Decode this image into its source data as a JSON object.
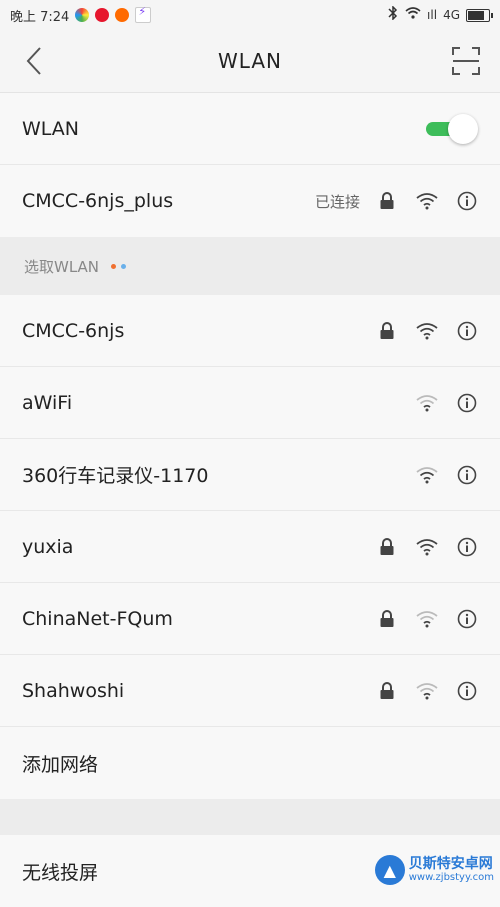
{
  "status_bar": {
    "time": "晚上 7:24",
    "network": "4G",
    "signal": "ıll"
  },
  "toolbar": {
    "title": "WLAN"
  },
  "wlan_toggle": {
    "label": "WLAN",
    "enabled": true
  },
  "connected": {
    "ssid": "CMCC-6njs_plus",
    "status": "已连接"
  },
  "section": {
    "title": "选取WLAN"
  },
  "networks": [
    {
      "ssid": "CMCC-6njs",
      "locked": true,
      "signal": "strong"
    },
    {
      "ssid": "aWiFi",
      "locked": false,
      "signal": "weak"
    },
    {
      "ssid": "360行车记录仪-1170",
      "locked": false,
      "signal": "weak"
    },
    {
      "ssid": "yuxia",
      "locked": true,
      "signal": "strong"
    },
    {
      "ssid": "ChinaNet-FQum",
      "locked": true,
      "signal": "weak"
    },
    {
      "ssid": "Shahwoshi",
      "locked": true,
      "signal": "weak"
    }
  ],
  "add_network": {
    "label": "添加网络"
  },
  "wireless_display": {
    "label": "无线投屏"
  },
  "watermark": {
    "name": "贝斯特安卓网",
    "url": "www.zjbstyy.com"
  },
  "colors": {
    "toggle_on": "#3dbd5a",
    "accent_blue": "#2a7ad6"
  }
}
